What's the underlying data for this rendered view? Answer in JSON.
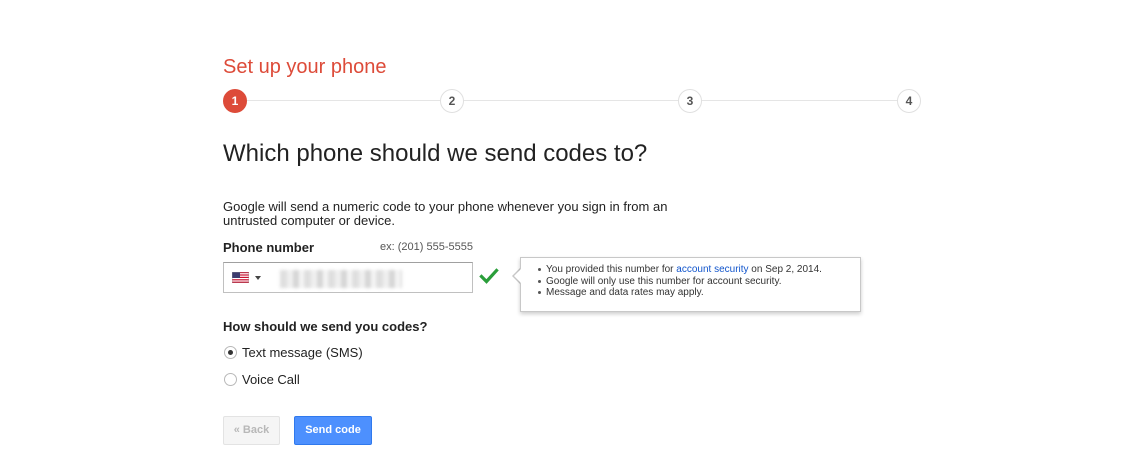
{
  "page": {
    "title": "Set up your phone",
    "accent_color": "#dd4b39"
  },
  "stepper": {
    "steps": [
      "1",
      "2",
      "3",
      "4"
    ],
    "active_step": 1
  },
  "main": {
    "heading": "Which phone should we send codes to?",
    "description": "Google will send a numeric code to your phone whenever you sign in from an untrusted computer or device."
  },
  "phone": {
    "label": "Phone number",
    "example": "ex: (201) 555-5555",
    "country_icon": "us-flag-icon",
    "verified_icon": "check-icon",
    "verified_color": "#2a9e3a"
  },
  "tooltip": {
    "item1_prefix": "You provided this number for ",
    "item1_link": "account security",
    "item1_suffix": " on Sep 2, 2014.",
    "item2": "Google will only use this number for account security.",
    "item3": "Message and data rates may apply."
  },
  "method": {
    "label": "How should we send you codes?",
    "options": [
      {
        "label": "Text message (SMS)",
        "selected": true
      },
      {
        "label": "Voice Call",
        "selected": false
      }
    ]
  },
  "buttons": {
    "back_label": "« Back",
    "send_label": "Send code",
    "primary_color": "#4d90fe"
  }
}
